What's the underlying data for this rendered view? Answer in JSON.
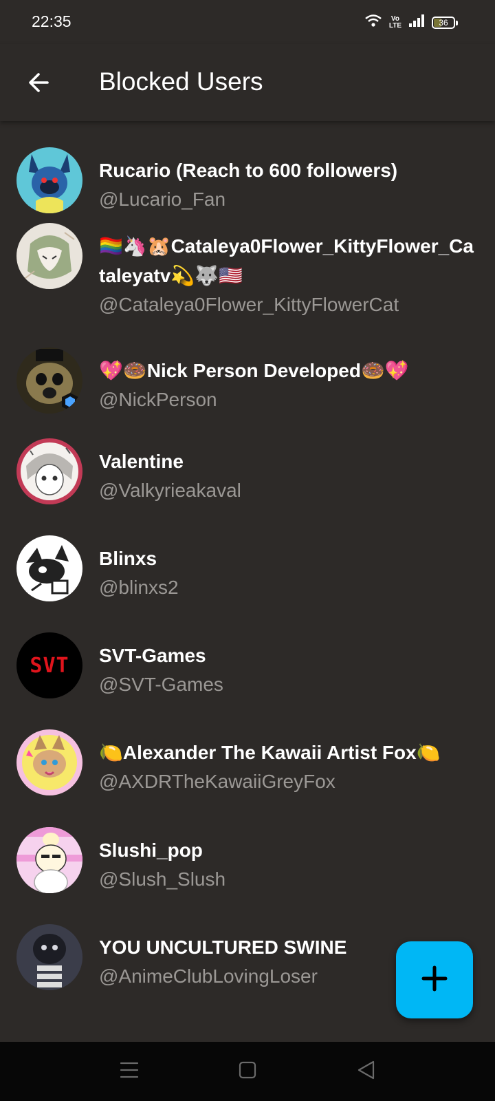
{
  "status_bar": {
    "time": "22:35",
    "network_label_top": "Vo",
    "network_label_bottom": "LTE",
    "battery_level": "36",
    "icons": [
      "wifi-icon",
      "volte-icon",
      "signal-icon",
      "battery-icon"
    ]
  },
  "header": {
    "title": "Blocked Users",
    "back_icon": "arrow-left-icon"
  },
  "users": [
    {
      "display_name": "Rucario (Reach to 600 followers)",
      "username": "@Lucario_Fan",
      "avatar_icon": "lucario-avatar"
    },
    {
      "display_name": "🏳️‍🌈🦄🐹Cataleya0Flower_KittyFlower_Cataleyatv💫🐺🇺🇸",
      "username": "@Cataleya0Flower_KittyFlowerCat",
      "avatar_icon": "sketch-avatar"
    },
    {
      "display_name": "💖🍩Nick Person Developed🍩💖",
      "username": "@NickPerson",
      "avatar_icon": "animatronic-avatar"
    },
    {
      "display_name": "Valentine",
      "username": "@Valkyrieakaval",
      "avatar_icon": "manga-avatar"
    },
    {
      "display_name": "Blinxs",
      "username": "@blinxs2",
      "avatar_icon": "cat-sketch-avatar"
    },
    {
      "display_name": "SVT-Games",
      "username": "@SVT-Games",
      "avatar_label": "SVT",
      "avatar_icon": "svt-logo-avatar"
    },
    {
      "display_name": "🍋Alexander The Kawaii Artist Fox🍋",
      "username": "@AXDRTheKawaiiGreyFox",
      "avatar_icon": "fox-avatar"
    },
    {
      "display_name": "Slushi_pop",
      "username": "@Slush_Slush",
      "avatar_icon": "pink-character-avatar"
    },
    {
      "display_name": "YOU UNCULTURED SWINE",
      "username": "@AnimeClubLovingLoser",
      "avatar_icon": "dark-character-avatar"
    }
  ],
  "fab": {
    "icon": "plus-icon"
  },
  "nav": {
    "icons": [
      "menu-icon",
      "home-square-icon",
      "back-triangle-icon"
    ]
  },
  "colors": {
    "background": "#2d2a28",
    "accent": "#00b7f5",
    "secondary_text": "#9b9895",
    "nav_bar": "#070707"
  }
}
